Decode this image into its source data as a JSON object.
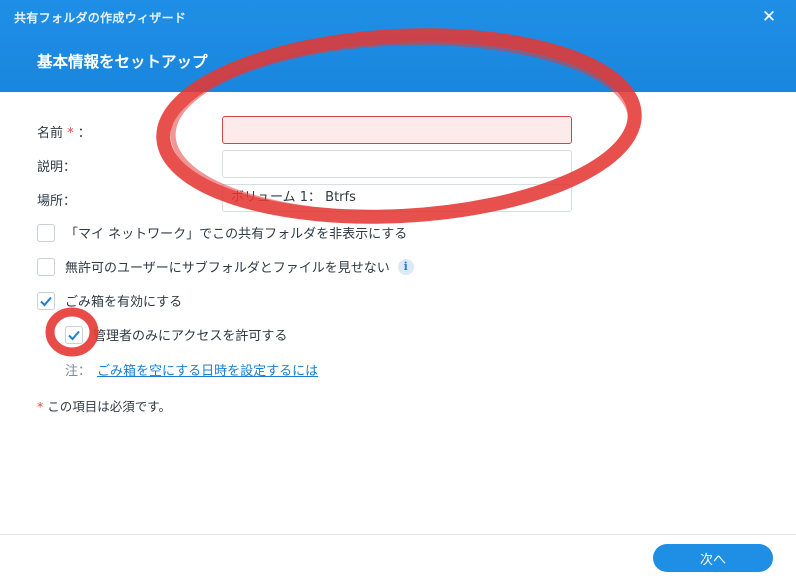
{
  "window": {
    "title": "共有フォルダの作成ウィザード",
    "close_glyph": "✕"
  },
  "step": {
    "title": "基本情報をセットアップ"
  },
  "form": {
    "name_label": "名前",
    "name_required_mark": "*",
    "name_label_suffix": "：",
    "name_value": "",
    "description_label": "説明：",
    "description_value": "",
    "location_label": "場所：",
    "location_value": "ボリューム 1： Btrfs"
  },
  "options": [
    {
      "label": "「マイ ネットワーク」でこの共有フォルダを非表示にする",
      "checked": false
    },
    {
      "label": "無許可のユーザーにサブフォルダとファイルを見せない",
      "checked": false,
      "info_icon": "i"
    },
    {
      "label": "ごみ箱を有効にする",
      "checked": true
    },
    {
      "label": "管理者のみにアクセスを許可する",
      "checked": true
    }
  ],
  "note": {
    "prefix": "注：",
    "link": "ごみ箱を空にする日時を設定するには"
  },
  "required_note": {
    "mark": "*",
    "text": " この項目は必須です。"
  },
  "footer": {
    "next_label": "次へ"
  },
  "colors": {
    "header": "#1f8fe6",
    "accent": "#1f8fe6",
    "annotation_red": "#e53935"
  }
}
